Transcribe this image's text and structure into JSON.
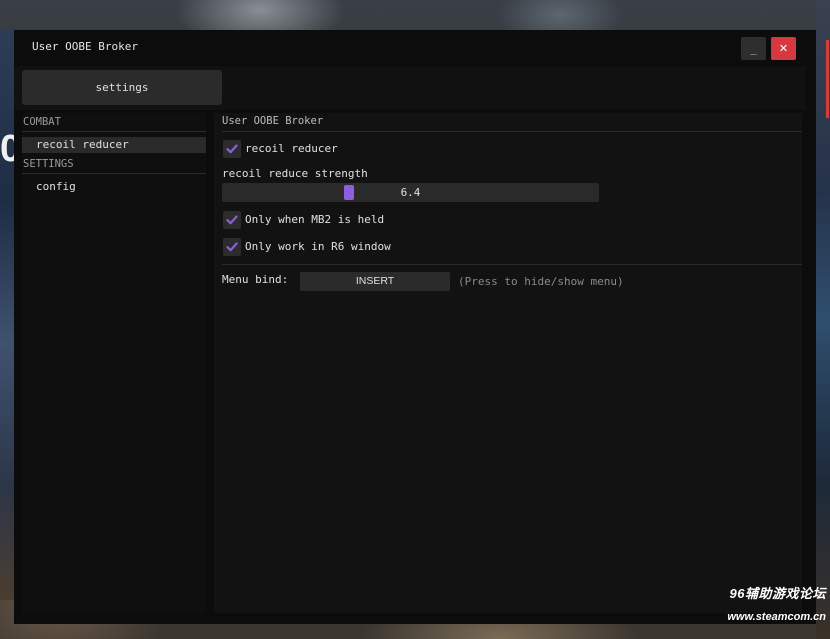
{
  "window": {
    "title": "User OOBE Broker",
    "minimize_label": "_",
    "close_label": "✕"
  },
  "topbar": {
    "tab_label": "settings"
  },
  "sidebar": {
    "sections": [
      {
        "header": "COMBAT",
        "items": [
          {
            "label": "recoil reducer",
            "active": true
          }
        ]
      },
      {
        "header": "SETTINGS",
        "items": [
          {
            "label": "config",
            "active": false
          }
        ]
      }
    ]
  },
  "content": {
    "header": "User OOBE Broker",
    "recoil_checkbox": {
      "label": "recoil reducer",
      "checked": true
    },
    "slider": {
      "label": "recoil reduce strength",
      "value": 6.4,
      "value_text": "6.4",
      "fraction": 0.33
    },
    "mb2_checkbox": {
      "label": "Only when MB2 is held",
      "checked": true
    },
    "r6_checkbox": {
      "label": "Only work in R6 window",
      "checked": true
    },
    "menu_bind": {
      "label": "Menu bind:",
      "key": "INSERT",
      "hint": "(Press to hide/show menu)"
    }
  },
  "watermark": {
    "line1": "96辅助游戏论坛",
    "line2": "www.steamcom.cn"
  },
  "colors": {
    "accent": "#8e5fdc",
    "close_button": "#d5393f",
    "window_bg": "#0c0c0c",
    "panel_bg": "#121212"
  },
  "icons": {
    "check": "check-icon"
  }
}
